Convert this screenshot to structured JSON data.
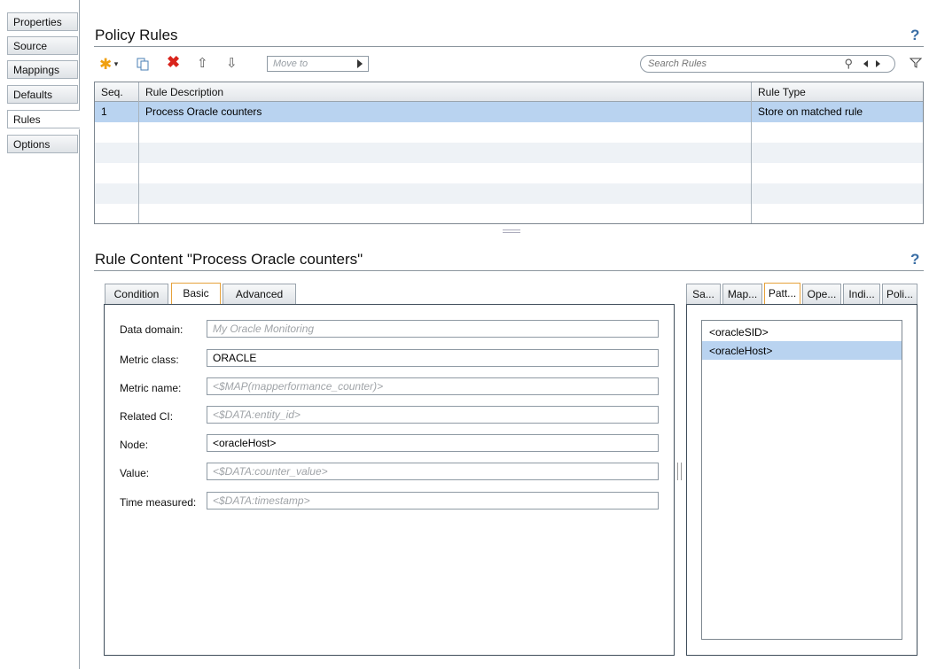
{
  "nav": {
    "items": [
      {
        "label": "Properties"
      },
      {
        "label": "Source"
      },
      {
        "label": "Mappings"
      },
      {
        "label": "Defaults"
      },
      {
        "label": "Rules"
      },
      {
        "label": "Options"
      }
    ],
    "active": "Rules"
  },
  "policy_rules": {
    "title": "Policy Rules",
    "help": "?",
    "toolbar": {
      "move_to_placeholder": "Move to",
      "search_placeholder": "Search Rules"
    },
    "columns": [
      "Seq.",
      "Rule Description",
      "Rule Type"
    ],
    "rows": [
      {
        "seq": "1",
        "description": "Process Oracle counters",
        "type": "Store on matched rule",
        "selected": true
      }
    ]
  },
  "rule_content": {
    "title": "Rule Content \"Process Oracle counters\"",
    "help": "?",
    "tabs": [
      "Condition",
      "Basic",
      "Advanced"
    ],
    "active_tab": "Basic",
    "fields": [
      {
        "label": "Data domain:",
        "value": "",
        "placeholder": "My Oracle Monitoring"
      },
      {
        "label": "Metric class:",
        "value": "ORACLE",
        "placeholder": ""
      },
      {
        "label": "Metric name:",
        "value": "",
        "placeholder": "<$MAP(mapperformance_counter)>"
      },
      {
        "label": "Related CI:",
        "value": "",
        "placeholder": "<$DATA:entity_id>"
      },
      {
        "label": "Node:",
        "value": "<oracleHost>",
        "placeholder": ""
      },
      {
        "label": "Value:",
        "value": "",
        "placeholder": "<$DATA:counter_value>"
      },
      {
        "label": "Time measured:",
        "value": "",
        "placeholder": "<$DATA:timestamp>"
      }
    ]
  },
  "side_panel": {
    "tabs": [
      "Sa...",
      "Map...",
      "Patt...",
      "Ope...",
      "Indi...",
      "Poli..."
    ],
    "active_tab": "Patt...",
    "items": [
      "<oracleSID>",
      "<oracleHost>"
    ],
    "selected_item": "<oracleHost>"
  },
  "icons": {
    "new": "asterisk-new-icon",
    "copy": "copy-icon",
    "delete": "delete-x-icon",
    "up": "move-up-icon",
    "down": "move-down-icon",
    "search": "magnifier-icon",
    "filter": "filter-icon"
  },
  "colors": {
    "selection": "#b9d3f0",
    "delete_red": "#d9241c",
    "new_orange": "#f0a010",
    "help_blue": "#3a6ea5",
    "active_tab_border": "#e6a23c"
  }
}
